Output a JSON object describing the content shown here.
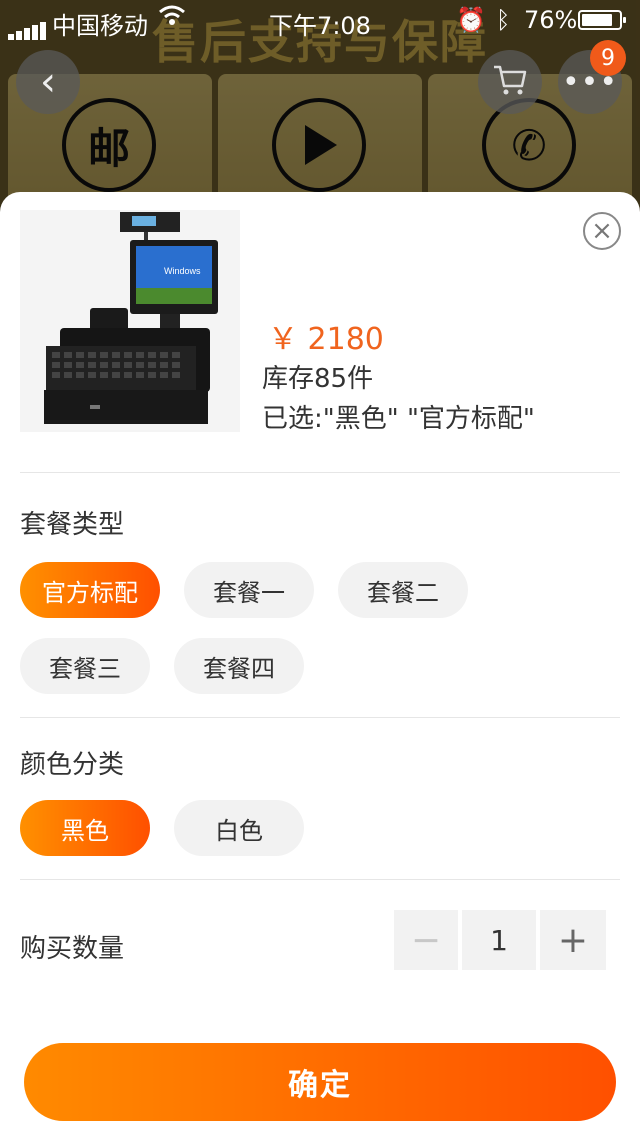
{
  "status_bar": {
    "carrier": "中国移动",
    "time": "下午7:08",
    "battery_pct": "76%",
    "icons": [
      "signal-icon",
      "wifi-icon",
      "alarm-icon",
      "bluetooth-icon",
      "battery-icon"
    ]
  },
  "background_page": {
    "banner_title": "售后支持与保障",
    "tiles": [
      {
        "icon": "mail-icon",
        "glyph": "邮"
      },
      {
        "icon": "play-icon",
        "glyph": "▶"
      },
      {
        "icon": "phone-icon",
        "glyph": "✆"
      }
    ]
  },
  "nav": {
    "back_icon": "back-icon",
    "cart_icon": "cart-icon",
    "more_icon": "more-icon",
    "badge_count": "9"
  },
  "product": {
    "price": "￥ 2180",
    "stock": "库存85件",
    "selected": "已选:\"黑色\" \"官方标配\""
  },
  "package_section": {
    "title": "套餐类型",
    "options": [
      "官方标配",
      "套餐一",
      "套餐二",
      "套餐三",
      "套餐四"
    ],
    "selected": "官方标配"
  },
  "color_section": {
    "title": "颜色分类",
    "options": [
      "黑色",
      "白色"
    ],
    "selected": "黑色"
  },
  "quantity": {
    "label": "购买数量",
    "value": "1",
    "minus": "−",
    "plus": "+"
  },
  "confirm_label": "确定",
  "colors": {
    "accent": "#ff5000",
    "accent_start": "#ff9000",
    "price": "#f0641e"
  }
}
